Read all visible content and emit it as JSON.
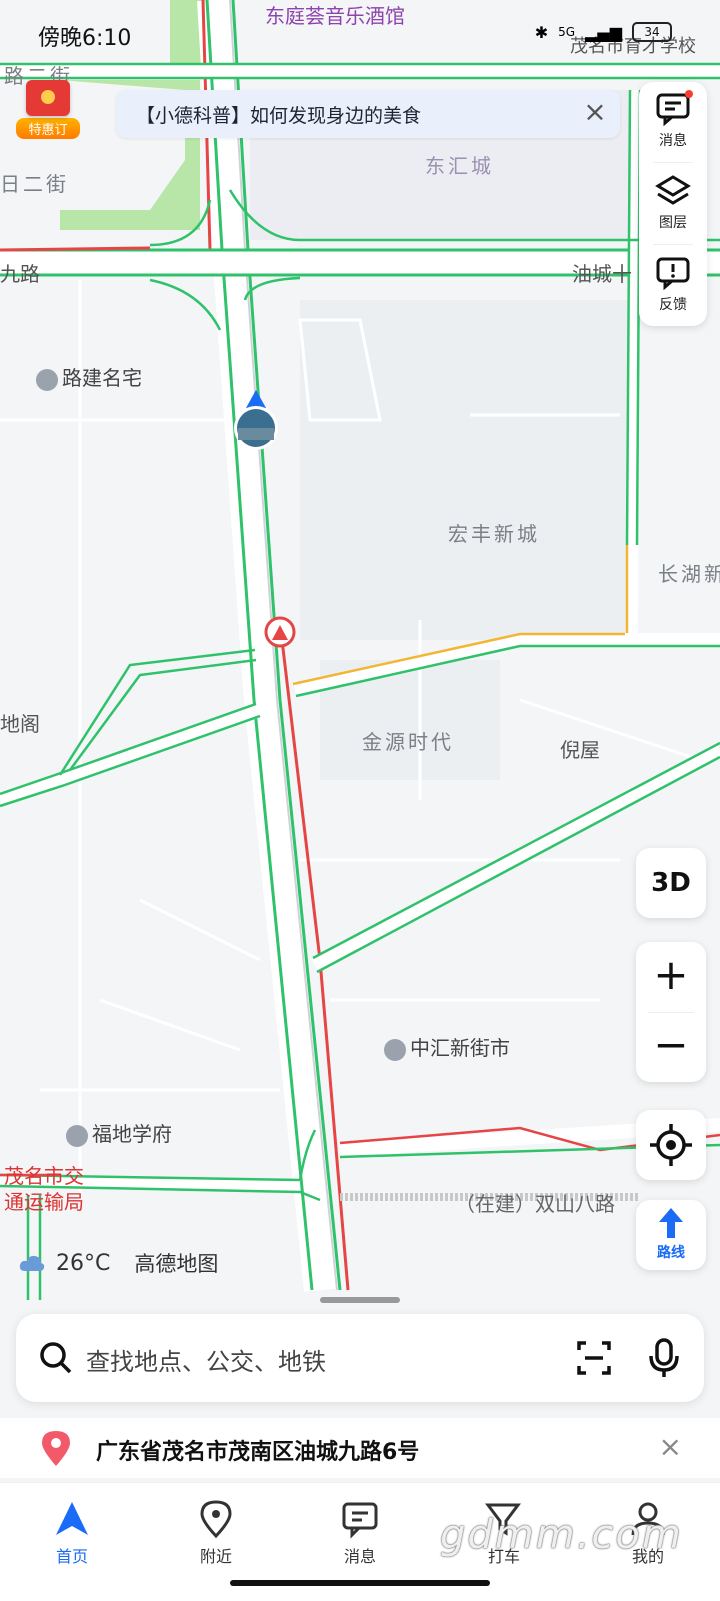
{
  "status_bar": {
    "time": "傍晚6:10",
    "battery": "34",
    "network": "5G"
  },
  "promo": {
    "label": "特惠订"
  },
  "banner": {
    "text": "【小德科普】如何发现身边的美食"
  },
  "side_panel": {
    "items": [
      {
        "label": "消息"
      },
      {
        "label": "图层"
      },
      {
        "label": "反馈"
      }
    ]
  },
  "map_labels": {
    "dongting": "东庭荟音乐酒馆",
    "dongting_right": "茂名市育才学校",
    "lu2": "路二街",
    "ri2": "日二街",
    "donghui": "东汇城",
    "jiulu": "九路",
    "youcheng": "油城十",
    "lujian": "路建名宅",
    "hongfeng": "宏丰新城",
    "changhu": "长湖新",
    "jinyuan": "金源时代",
    "nidu": "倪屋",
    "dige": "地阁",
    "zhonghui": "中汇新街市",
    "fudi": "福地学府",
    "jiaotong1": "茂名市交",
    "jiaotong2": "通运输局",
    "shuangshan": "（在建）双山八路"
  },
  "controls": {
    "btn_3d": "3D",
    "route": "路线"
  },
  "weather": {
    "temp": "26°C",
    "brand": "高德地图"
  },
  "search": {
    "placeholder": "查找地点、公交、地铁"
  },
  "address": {
    "text": "广东省茂名市茂南区油城九路6号"
  },
  "tabs": [
    {
      "label": "首页"
    },
    {
      "label": "附近"
    },
    {
      "label": "消息"
    },
    {
      "label": "打车"
    },
    {
      "label": "我的"
    }
  ],
  "watermark": "gdmm.com",
  "colors": {
    "accent": "#1a6cf7",
    "traffic_green": "#2fc26b",
    "traffic_red": "#e64545",
    "traffic_yellow": "#f2b632"
  }
}
